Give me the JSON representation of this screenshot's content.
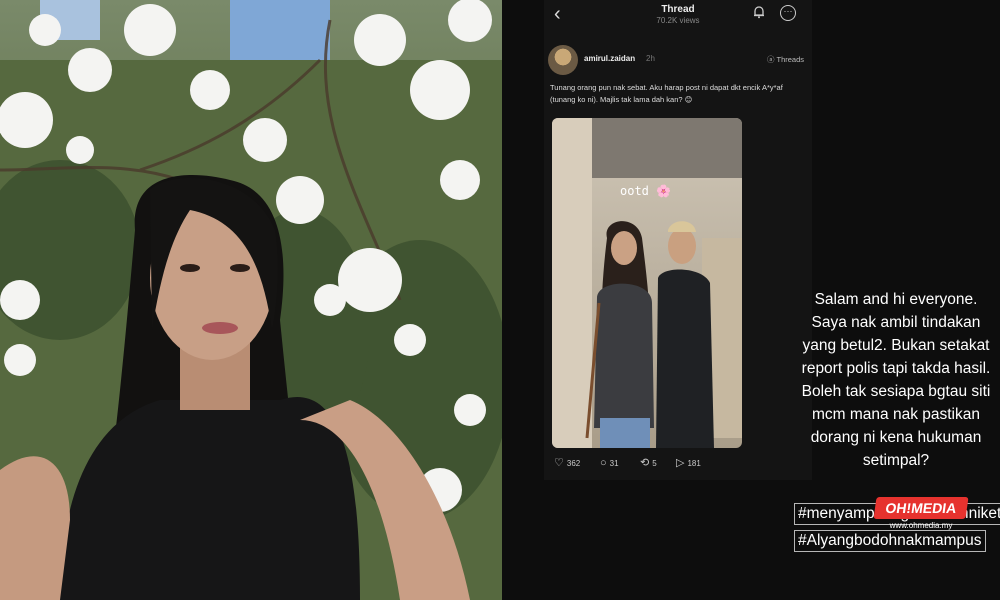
{
  "thread": {
    "title": "Thread",
    "views": "70.2K views",
    "username": "amirul.zaidan",
    "time": "2h",
    "platform_badge": "Threads",
    "post_text": "Tunang orang pun nak sebat. Aku harap post ni dapat dkt encik A*y*af (tunang ko ni). Majlis tak lama dah kan? 😊",
    "image_caption": "ootd 🌸",
    "likes": "362",
    "comments": "31",
    "reposts": "5",
    "shares": "181"
  },
  "story": {
    "lines": [
      "Salam and hi everyone.",
      "Saya nak ambil tindakan",
      "yang betul2. Bukan setakat",
      "report polis tapi takda hasil.",
      "Boleh tak sesiapa bgtau siti",
      "mcm mana nak pastikan",
      "dorang ni kena hukuman",
      "setimpal?"
    ],
    "hashtag_1": "#menyampahdgnmacamniket",
    "hashtag_2": "#Alyangbodohnakmampus"
  },
  "watermark": {
    "brand": "OH!MEDIA",
    "url": "www.ohmedia.my"
  },
  "icons": [
    "back-arrow-icon",
    "bell-icon",
    "more-options-icon",
    "heart-icon",
    "comment-icon",
    "repost-icon",
    "share-icon"
  ],
  "colors": {
    "background": "#0d0d0d",
    "card": "#141414",
    "watermark_red": "#e6322e"
  }
}
